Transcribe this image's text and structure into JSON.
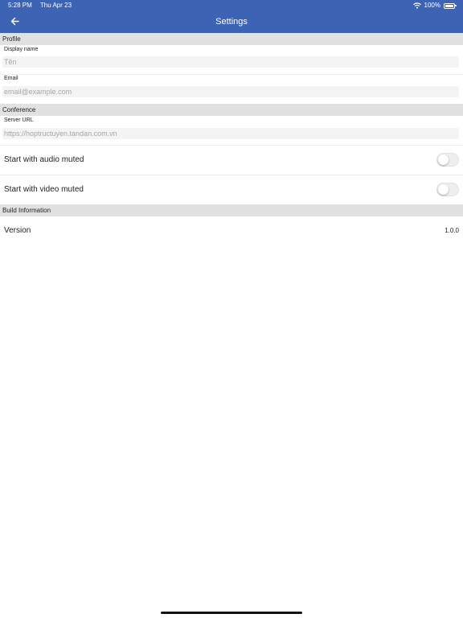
{
  "status_bar": {
    "time": "5:28 PM",
    "date": "Thu Apr 23",
    "battery": "100%"
  },
  "nav": {
    "title": "Settings",
    "back_icon": "arrow-left-icon"
  },
  "profile": {
    "header": "Profile",
    "display_name": {
      "label": "Display name",
      "placeholder": "Tên",
      "value": ""
    },
    "email": {
      "label": "Email",
      "placeholder": "email@example.com",
      "value": ""
    }
  },
  "conference": {
    "header": "Conference",
    "server_url": {
      "label": "Server URL",
      "placeholder": "https://hoptructuyen.tandan.com.vn",
      "value": ""
    },
    "audio_muted": {
      "label": "Start with audio muted",
      "on": false
    },
    "video_muted": {
      "label": "Start with video muted",
      "on": false
    }
  },
  "build": {
    "header": "Build Information",
    "version_label": "Version",
    "version_value": "1.0.0"
  },
  "colors": {
    "accent": "#3d63b5",
    "section_bg": "#e1e1e1",
    "input_bg": "#f4f4f4",
    "placeholder": "#a6a6a6"
  }
}
